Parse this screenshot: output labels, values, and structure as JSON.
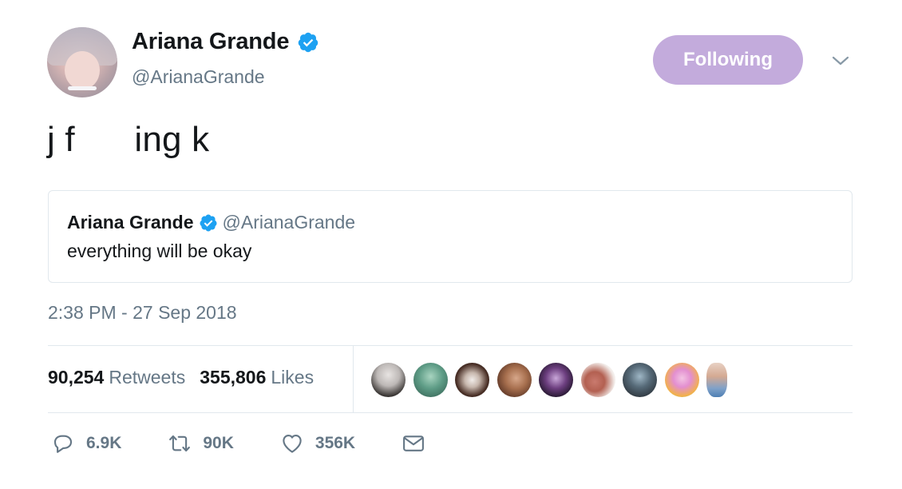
{
  "author": {
    "name": "Ariana Grande",
    "handle": "@ArianaGrande",
    "verified": true
  },
  "follow_button": {
    "label": "Following",
    "color": "#c3abdc"
  },
  "tweet": {
    "text": "j f      ing k",
    "timestamp": "2:38 PM - 27 Sep 2018"
  },
  "quoted_tweet": {
    "name": "Ariana Grande",
    "handle": "@ArianaGrande",
    "text": "everything will be okay"
  },
  "stats": {
    "retweets_count": "90,254",
    "retweets_label": "Retweets",
    "likes_count": "355,806",
    "likes_label": "Likes"
  },
  "actions": {
    "reply_count": "6.9K",
    "retweet_count": "90K",
    "like_count": "356K"
  },
  "colors": {
    "verified": "#1da1f2",
    "secondary_text": "#657786",
    "border": "#e1e8ed"
  },
  "icons": [
    "verified-badge-icon",
    "chevron-down-icon",
    "reply-icon",
    "retweet-icon",
    "heart-icon",
    "mail-icon"
  ]
}
